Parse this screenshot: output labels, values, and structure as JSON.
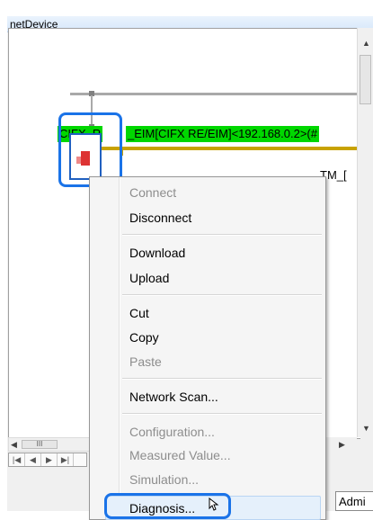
{
  "window": {
    "title": "netDevice"
  },
  "diagram": {
    "device_label_left": "CIFX_R",
    "device_label_right": "_EIM[CIFX RE/EIM]<192.168.0.2>(#",
    "secondary_device_label": "TM_["
  },
  "context_menu": {
    "items": [
      {
        "label": "Connect",
        "enabled": false
      },
      {
        "label": "Disconnect",
        "enabled": true
      },
      {
        "label": "Download",
        "enabled": true
      },
      {
        "label": "Upload",
        "enabled": true
      },
      {
        "label": "Cut",
        "enabled": true
      },
      {
        "label": "Copy",
        "enabled": true
      },
      {
        "label": "Paste",
        "enabled": false
      },
      {
        "label": "Network Scan...",
        "enabled": true
      },
      {
        "label": "Configuration...",
        "enabled": false
      },
      {
        "label": "Measured Value...",
        "enabled": false
      },
      {
        "label": "Simulation...",
        "enabled": false
      },
      {
        "label": "Diagnosis...",
        "enabled": true,
        "hovered": true
      }
    ]
  },
  "status": {
    "admin_tab": "Admi"
  },
  "scrollbar": {
    "thumb_grip": "III"
  },
  "colors": {
    "highlight": "#1a73e8",
    "device_label_bg": "#00d700",
    "bus_gold": "#c8a200"
  }
}
